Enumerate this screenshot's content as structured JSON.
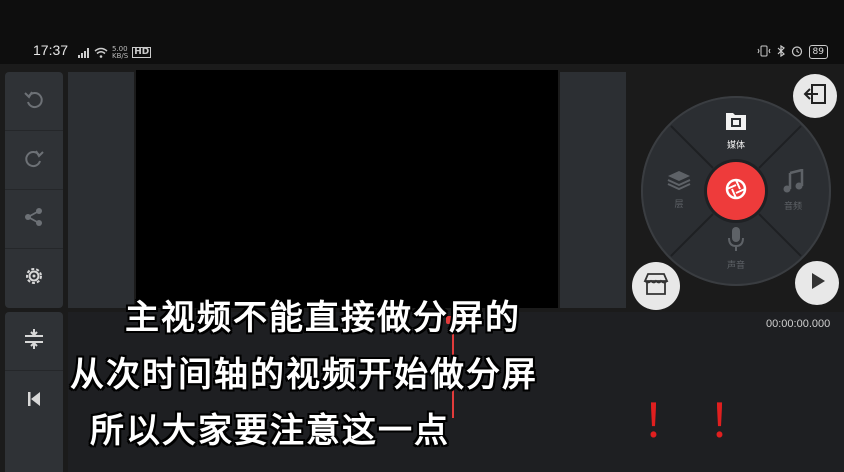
{
  "status_bar": {
    "time": "17:37",
    "network_speed_top": "5.00",
    "network_speed_bottom": "KB/S",
    "hd_badge": "HD",
    "battery": "89"
  },
  "toolbar": {
    "undo_icon": "undo-icon",
    "redo_icon": "redo-icon",
    "share_icon": "share-icon",
    "settings_icon": "gear-icon",
    "adjust_icon": "split-adjust-icon",
    "skip_start_icon": "skip-to-start-icon"
  },
  "media_wheel": {
    "media_label": "媒体",
    "layer_label": "层",
    "audio_label": "音频",
    "voice_label": "声音"
  },
  "playback": {
    "timecode": "00:00:00.000"
  },
  "subtitles": {
    "line1": "主视频不能直接做分屏的",
    "line2": "从次时间轴的视频开始做分屏",
    "line3": "所以大家要注意这一点",
    "exclaim1": "！",
    "exclaim2": "！"
  },
  "colors": {
    "record": "#ee3b3b",
    "panel": "#2f3236",
    "subtitle_accent": "#e01f1f"
  }
}
